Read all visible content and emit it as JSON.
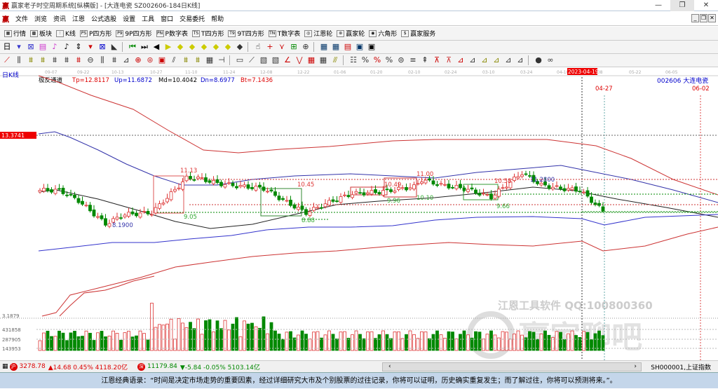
{
  "window": {
    "title": "赢家老子时空周期系统[纵横版] - [大连电瓷  SZ002606-184日K线]",
    "min": "—",
    "max": "❐",
    "close": "✕"
  },
  "menu": [
    "文件",
    "浏览",
    "资讯",
    "江恩",
    "公式选股",
    "设置",
    "工具",
    "窗口",
    "交易委托",
    "帮助"
  ],
  "mdi": [
    "_",
    "❐",
    "✕"
  ],
  "toolbar": [
    {
      "icon": "▦",
      "label": "行情"
    },
    {
      "icon": "▩",
      "label": "板块"
    },
    {
      "icon": "⫶",
      "label": "K线"
    },
    {
      "icon": "PS",
      "label": "P四方形"
    },
    {
      "icon": "P9",
      "label": "9P四方形"
    },
    {
      "icon": "PN",
      "label": "P数字表"
    },
    {
      "icon": "TS",
      "label": "T四方形"
    },
    {
      "icon": "T9",
      "label": "9T四方形"
    },
    {
      "icon": "TN",
      "label": "T数字表"
    },
    {
      "icon": "◎",
      "label": "江恩轮"
    },
    {
      "icon": "⊛",
      "label": "赢家轮"
    },
    {
      "icon": "◉",
      "label": "六角形"
    },
    {
      "icon": "$",
      "label": "赢家服务"
    }
  ],
  "chart": {
    "period": "日K线",
    "indicator": "极反通道",
    "tp": "Tp=12.8117",
    "up": "Up=11.6872",
    "md": "Md=10.4042",
    "dn": "Dn=8.6977",
    "bt": "Bt=7.1436",
    "stock": "002606  大连电瓷",
    "dates": [
      "09-07",
      "09-22",
      "10-13",
      "10-27",
      "11-10",
      "11-24",
      "12-08",
      "12-22",
      "01-06",
      "01-20",
      "02-10",
      "02-24",
      "03-10",
      "03-24",
      "04-10",
      "05-08",
      "05-22",
      "06-05"
    ],
    "cursor_date": "2023-04-19",
    "marker_dates": [
      "04-27",
      "06-02"
    ],
    "price_tag": "13.3741",
    "labels": [
      "11.13",
      "9.05",
      "8.1900",
      "10.45",
      "8.88",
      "10.49",
      "9.96",
      "11.00",
      "10.10",
      "10.58",
      "9.66",
      "11.2800"
    ],
    "low_axis": "3.1879",
    "vol_axis": [
      "431858",
      "287905",
      "143953"
    ],
    "watermark1": "江恩工具软件  QQ:100800360",
    "watermark2": "赢家聊吧",
    "price_path": [
      [
        0,
        10.2
      ],
      [
        5,
        10.2
      ],
      [
        10,
        9.6
      ],
      [
        17,
        8.25
      ],
      [
        22,
        8.8
      ],
      [
        29,
        8.9
      ],
      [
        34,
        10.0
      ],
      [
        38,
        10.9
      ],
      [
        41,
        10.9
      ],
      [
        46,
        10.6
      ],
      [
        51,
        10.45
      ],
      [
        58,
        10.3
      ],
      [
        64,
        9.5
      ],
      [
        69,
        8.9
      ],
      [
        76,
        9.6
      ],
      [
        81,
        10.0
      ],
      [
        88,
        10.1
      ],
      [
        97,
        10.4
      ],
      [
        99,
        10.8
      ],
      [
        104,
        10.5
      ],
      [
        110,
        10.3
      ],
      [
        117,
        9.8
      ],
      [
        121,
        10.5
      ],
      [
        125,
        11.2
      ],
      [
        130,
        10.5
      ],
      [
        135,
        10.3
      ],
      [
        140,
        10.2
      ],
      [
        144,
        9.4
      ],
      [
        146,
        9.0
      ]
    ]
  },
  "status": {
    "idx1": "3278.78",
    "chg1": "▲14.68 0.45% 4118.20亿",
    "idx2": "11179.84",
    "chg2": "▼-5.84 -0.05% 5103.14亿",
    "sym": "SH000001,上证指数"
  },
  "quote": "江恩经典语录：“时间是决定市场走势的重要因素，经过详细研究大市及个别股票的过往记录，你将可以证明，历史确实重复发生；而了解过往，你将可以预测将来。”。"
}
